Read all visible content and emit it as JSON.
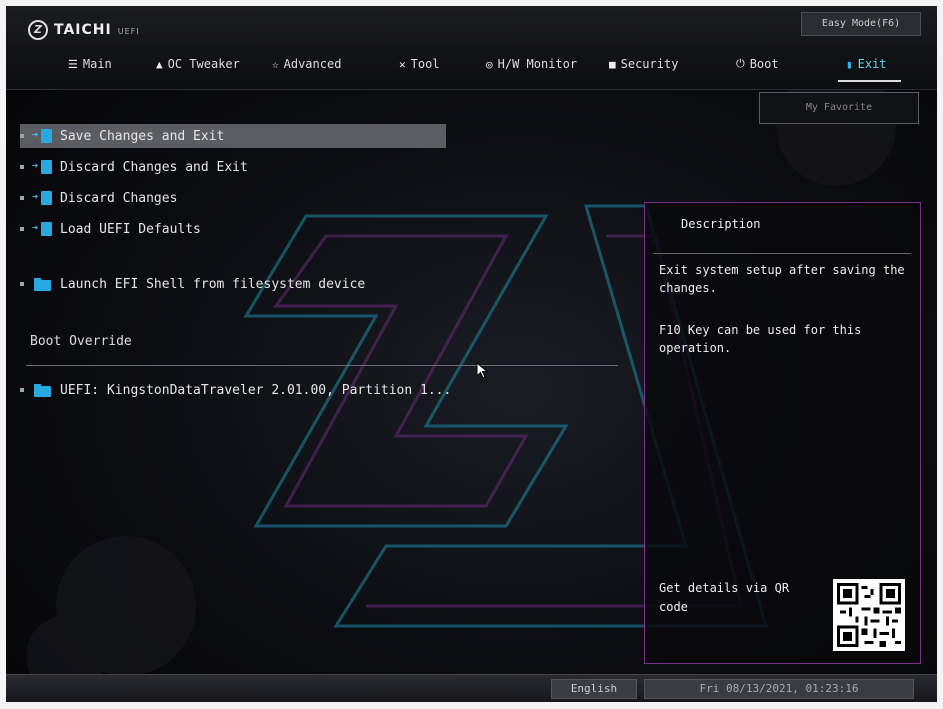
{
  "header": {
    "logo_brand": "TAICHI",
    "logo_sub": "UEFI",
    "logo_mark": "Z",
    "easy_mode_button": "Easy Mode(F6)"
  },
  "tabs": [
    {
      "label": "Main",
      "icon": "list-icon",
      "active": false
    },
    {
      "label": "OC Tweaker",
      "icon": "flask-icon",
      "active": false
    },
    {
      "label": "Advanced",
      "icon": "star-icon",
      "active": false
    },
    {
      "label": "Tool",
      "icon": "tools-icon",
      "active": false
    },
    {
      "label": "H/W Monitor",
      "icon": "monitor-icon",
      "active": false
    },
    {
      "label": "Security",
      "icon": "shield-icon",
      "active": false
    },
    {
      "label": "Boot",
      "icon": "power-icon",
      "active": false
    },
    {
      "label": "Exit",
      "icon": "exit-icon",
      "active": true
    }
  ],
  "favorite_button": "My Favorite",
  "menu": {
    "items": [
      {
        "label": "Save Changes and Exit",
        "icon": "exit-icon",
        "selected": true
      },
      {
        "label": "Discard Changes and Exit",
        "icon": "exit-icon",
        "selected": false
      },
      {
        "label": "Discard Changes",
        "icon": "exit-icon",
        "selected": false
      },
      {
        "label": "Load UEFI Defaults",
        "icon": "exit-icon",
        "selected": false
      },
      {
        "label": "Launch EFI Shell from filesystem device",
        "icon": "folder-icon",
        "selected": false
      }
    ],
    "boot_override_label": "Boot Override",
    "boot_override_items": [
      {
        "label": "UEFI: KingstonDataTraveler 2.01.00, Partition 1...",
        "icon": "folder-icon"
      }
    ]
  },
  "description": {
    "title": "Description",
    "text1": "Exit system setup after saving the changes.",
    "text2": "F10 Key can be used for this operation.",
    "qr_text": "Get details via QR code"
  },
  "footer": {
    "language": "English",
    "datetime": "Fri 08/13/2021, 01:23:16"
  },
  "colors": {
    "accent": "#2aa9e0",
    "selected_row": "#5c5d62",
    "panel_border": "#7b2f86"
  }
}
